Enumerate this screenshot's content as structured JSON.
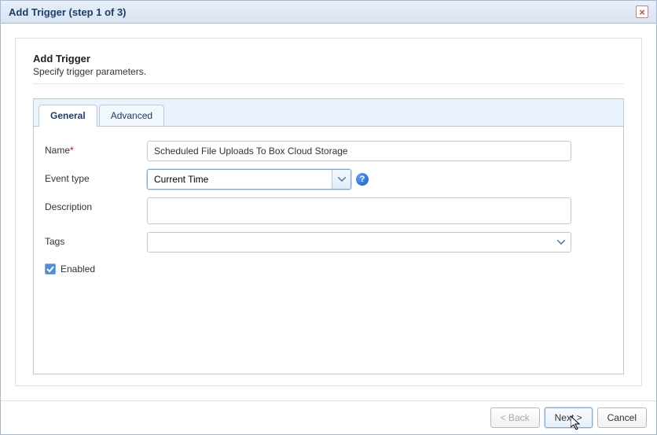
{
  "dialog": {
    "title": "Add Trigger (step 1 of 3)"
  },
  "section": {
    "title": "Add Trigger",
    "subtitle": "Specify trigger parameters."
  },
  "tabs": {
    "general": "General",
    "advanced": "Advanced"
  },
  "form": {
    "name_label": "Name",
    "name_value": "Scheduled File Uploads To Box Cloud Storage",
    "event_type_label": "Event type",
    "event_type_value": "Current Time",
    "description_label": "Description",
    "description_value": "",
    "tags_label": "Tags",
    "tags_value": "",
    "enabled_label": "Enabled",
    "enabled_checked": true,
    "help_glyph": "?"
  },
  "buttons": {
    "back": "< Back",
    "next": "Next >",
    "cancel": "Cancel"
  },
  "icons": {
    "close": "×"
  }
}
